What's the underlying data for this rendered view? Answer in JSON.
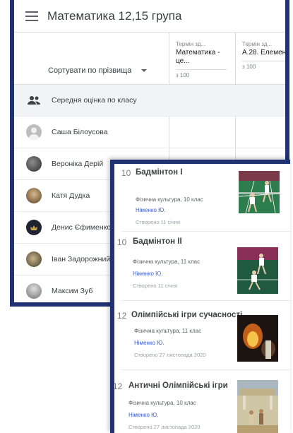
{
  "gradebook": {
    "title": "Математика 12,15 група",
    "sort_label": "Сортувати по прізвища",
    "assignments": [
      {
        "due": "Термін зд...",
        "name": "Математика - це...",
        "points": "з 100"
      },
      {
        "due": "Термін зд...",
        "name": "А.28. Елемент...",
        "points": "з 100"
      }
    ],
    "average_label": "Середня оцінка по класу",
    "students": [
      {
        "name": "Саша Білоусова",
        "avatar": "placeholder-avatar"
      },
      {
        "name": "Вероніка Дерій",
        "avatar": "photo-avatar"
      },
      {
        "name": "Катя Дудка",
        "avatar": "photo-avatar"
      },
      {
        "name": "Денис Єфименко",
        "avatar": "photo-avatar"
      },
      {
        "name": "Іван Задорожний",
        "avatar": "photo-avatar"
      },
      {
        "name": "Максим Зуб",
        "avatar": "photo-avatar"
      }
    ]
  },
  "courses": [
    {
      "number": "10",
      "title": "Бадмінтон І",
      "subject": "Фізична культура, 10 клас",
      "teacher": "Німенко Ю.",
      "created": "Створено 11 січня",
      "thumb": "badminton-doubles-image"
    },
    {
      "number": "10",
      "title": "Бадмінтон ІІ",
      "subject": "Фізична культура, 11 клас",
      "teacher": "Німенко Ю.",
      "created": "Створено 11 січня",
      "thumb": "badminton-players-image"
    },
    {
      "number": "12",
      "title": "Олімпійські ігри сучасності",
      "subject": "Фізична культура, 11 клас",
      "teacher": "Німенко Ю.",
      "created": "Створено 27 листопада 2020",
      "thumb": "olympic-torch-image"
    },
    {
      "number": "12",
      "title": "Античні Олімпійські ігри",
      "subject": "Фізична культура, 10 клас",
      "teacher": "Німенко Ю.",
      "created": "Створено 27 листопада 2020",
      "thumb": "ancient-olympics-painting-image"
    }
  ],
  "colors": {
    "frame": "#1f3273",
    "teacher_link": "#3c5ec9",
    "avg_row": "#f1f3f4"
  }
}
